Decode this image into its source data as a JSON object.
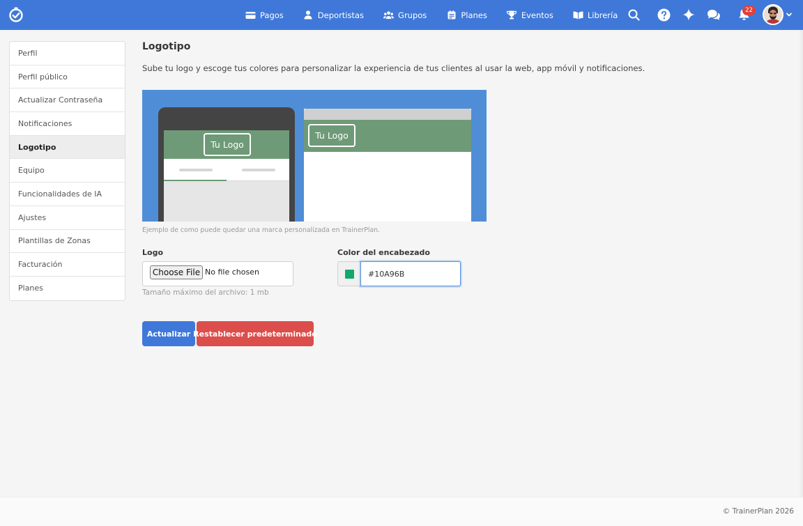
{
  "nav": {
    "items": [
      {
        "label": "Pagos",
        "icon": "card-icon"
      },
      {
        "label": "Deportistas",
        "icon": "person-icon"
      },
      {
        "label": "Grupos",
        "icon": "group-icon"
      },
      {
        "label": "Planes",
        "icon": "calendar-icon"
      },
      {
        "label": "Eventos",
        "icon": "trophy-icon"
      },
      {
        "label": "Librería",
        "icon": "book-icon"
      }
    ],
    "notification_count": "22"
  },
  "sidebar": {
    "items": [
      {
        "label": "Perfil"
      },
      {
        "label": "Perfil público"
      },
      {
        "label": "Actualizar Contraseña"
      },
      {
        "label": "Notificaciones"
      },
      {
        "label": "Logotipo",
        "active": true
      },
      {
        "label": "Equipo"
      },
      {
        "label": "Funcionalidades de IA"
      },
      {
        "label": "Ajustes"
      },
      {
        "label": "Plantillas de Zonas"
      },
      {
        "label": "Facturación"
      },
      {
        "label": "Planes"
      }
    ]
  },
  "main": {
    "title": "Logotipo",
    "description": "Sube tu logo y escoge tus colores para personalizar la experiencia de tus clientes al usar la web, app móvil y notificaciones.",
    "preview": {
      "phone_logo": "Tu Logo",
      "desktop_logo": "Tu Logo",
      "caption": "Ejemplo de como puede quedar una marca personalizada en TrainerPlan."
    },
    "logo_field": {
      "label": "Logo",
      "button": "Choose File",
      "status": "No file chosen",
      "help": "Tamaño máximo del archivo: 1 mb"
    },
    "color_field": {
      "label": "Color del encabezado",
      "value": "#10A96B"
    },
    "actions": {
      "update": "Actualizar",
      "reset": "Restablecer predeterminado"
    }
  },
  "footer": {
    "copyright": "© TrainerPlan 2026"
  },
  "colors": {
    "navbar": "#3f78d8",
    "header_swatch": "#10A96B",
    "preview_bg": "#4f8ed6",
    "preview_header": "#6e9a78",
    "danger": "#dc4e4b"
  }
}
